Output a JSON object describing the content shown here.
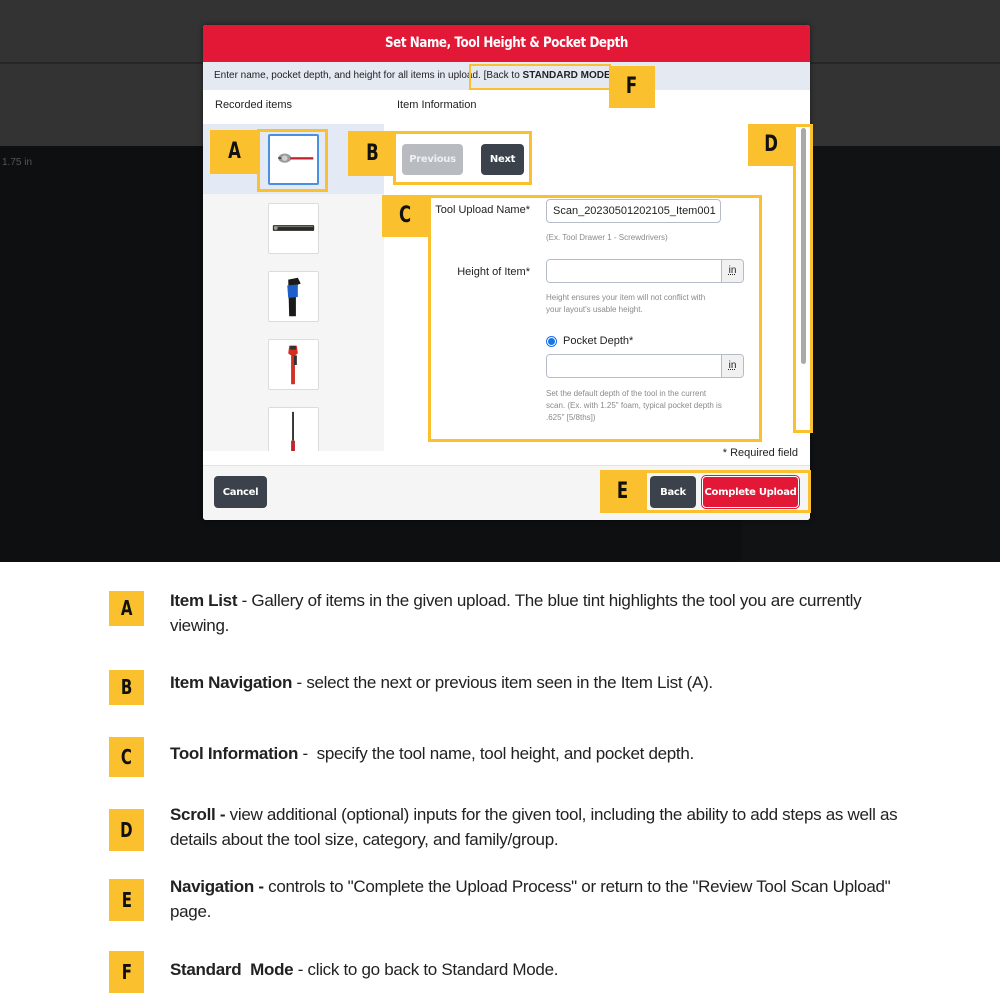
{
  "background": {
    "measure_label": "1.75 in"
  },
  "modal": {
    "title": "Set Name, Tool Height & Pocket Depth",
    "instructions": "Enter name, pocket depth, and height for all items in upload.",
    "standard_mode_link": {
      "prefix": "[Back to ",
      "bold": "STANDARD MODE",
      "suffix": "]"
    },
    "columns": {
      "left": "Recorded items",
      "right": "Item Information"
    },
    "gallery": {
      "items": [
        {
          "icon": "torque-wrench-icon",
          "selected": true
        },
        {
          "icon": "flat-bar-tool-icon",
          "selected": false
        },
        {
          "icon": "hex-key-set-icon",
          "selected": false
        },
        {
          "icon": "pipe-wrench-icon",
          "selected": false
        },
        {
          "icon": "screwdriver-icon",
          "selected": false
        }
      ]
    },
    "navigation": {
      "previous": "Previous",
      "next": "Next"
    },
    "form": {
      "tool_name": {
        "label": "Tool Upload Name*",
        "value": "Scan_20230501202105_Item001",
        "help": "(Ex. Tool Drawer 1 - Screwdrivers)"
      },
      "height": {
        "label": "Height of Item*",
        "value": "",
        "unit": "in",
        "help_line1": "Height ensures your item will not conflict with",
        "help_line2": "your layout's usable height."
      },
      "pocket_depth": {
        "label": "Pocket Depth*",
        "selected": true,
        "value": "",
        "unit": "in",
        "help_line1": "Set the default depth of the tool in the current",
        "help_line2": "scan. (Ex. with 1.25\" foam, typical pocket depth is",
        "help_line3": ".625\" [5/8ths])"
      }
    },
    "required_note": "* Required field",
    "footer": {
      "cancel": "Cancel",
      "back": "Back",
      "complete": "Complete Upload"
    }
  },
  "callouts": [
    "A",
    "B",
    "C",
    "D",
    "E",
    "F"
  ],
  "legend": [
    {
      "tag": "A",
      "title": "Item List",
      "sep": " - ",
      "text": "Gallery of items in the given upload. The blue tint highlights the tool you are currently viewing."
    },
    {
      "tag": "B",
      "title": "Item Navigation",
      "sep": " - ",
      "text": "select the next or previous item seen in the Item List (A)."
    },
    {
      "tag": "C",
      "title": "Tool Information",
      "sep": " -  ",
      "text": "specify the tool name, tool height, and pocket depth."
    },
    {
      "tag": "D",
      "title": "Scroll -",
      "sep": " ",
      "text": "view additional (optional) inputs for the given tool, including the ability to add steps as well as details about the tool size, category, and family/group."
    },
    {
      "tag": "E",
      "title": "Navigation -",
      "sep": " ",
      "text": "controls to \"Complete the Upload Process\" or return to the \"Review Tool Scan Upload\" page."
    },
    {
      "tag": "F",
      "title": "Standard  Mode",
      "sep": " - ",
      "text": "click to go back to Standard Mode."
    }
  ],
  "colors": {
    "brand_red": "#e31837",
    "dark_button": "#3b424b",
    "callout_yellow": "#fbc02d",
    "selection_blue": "#4a90e2"
  }
}
